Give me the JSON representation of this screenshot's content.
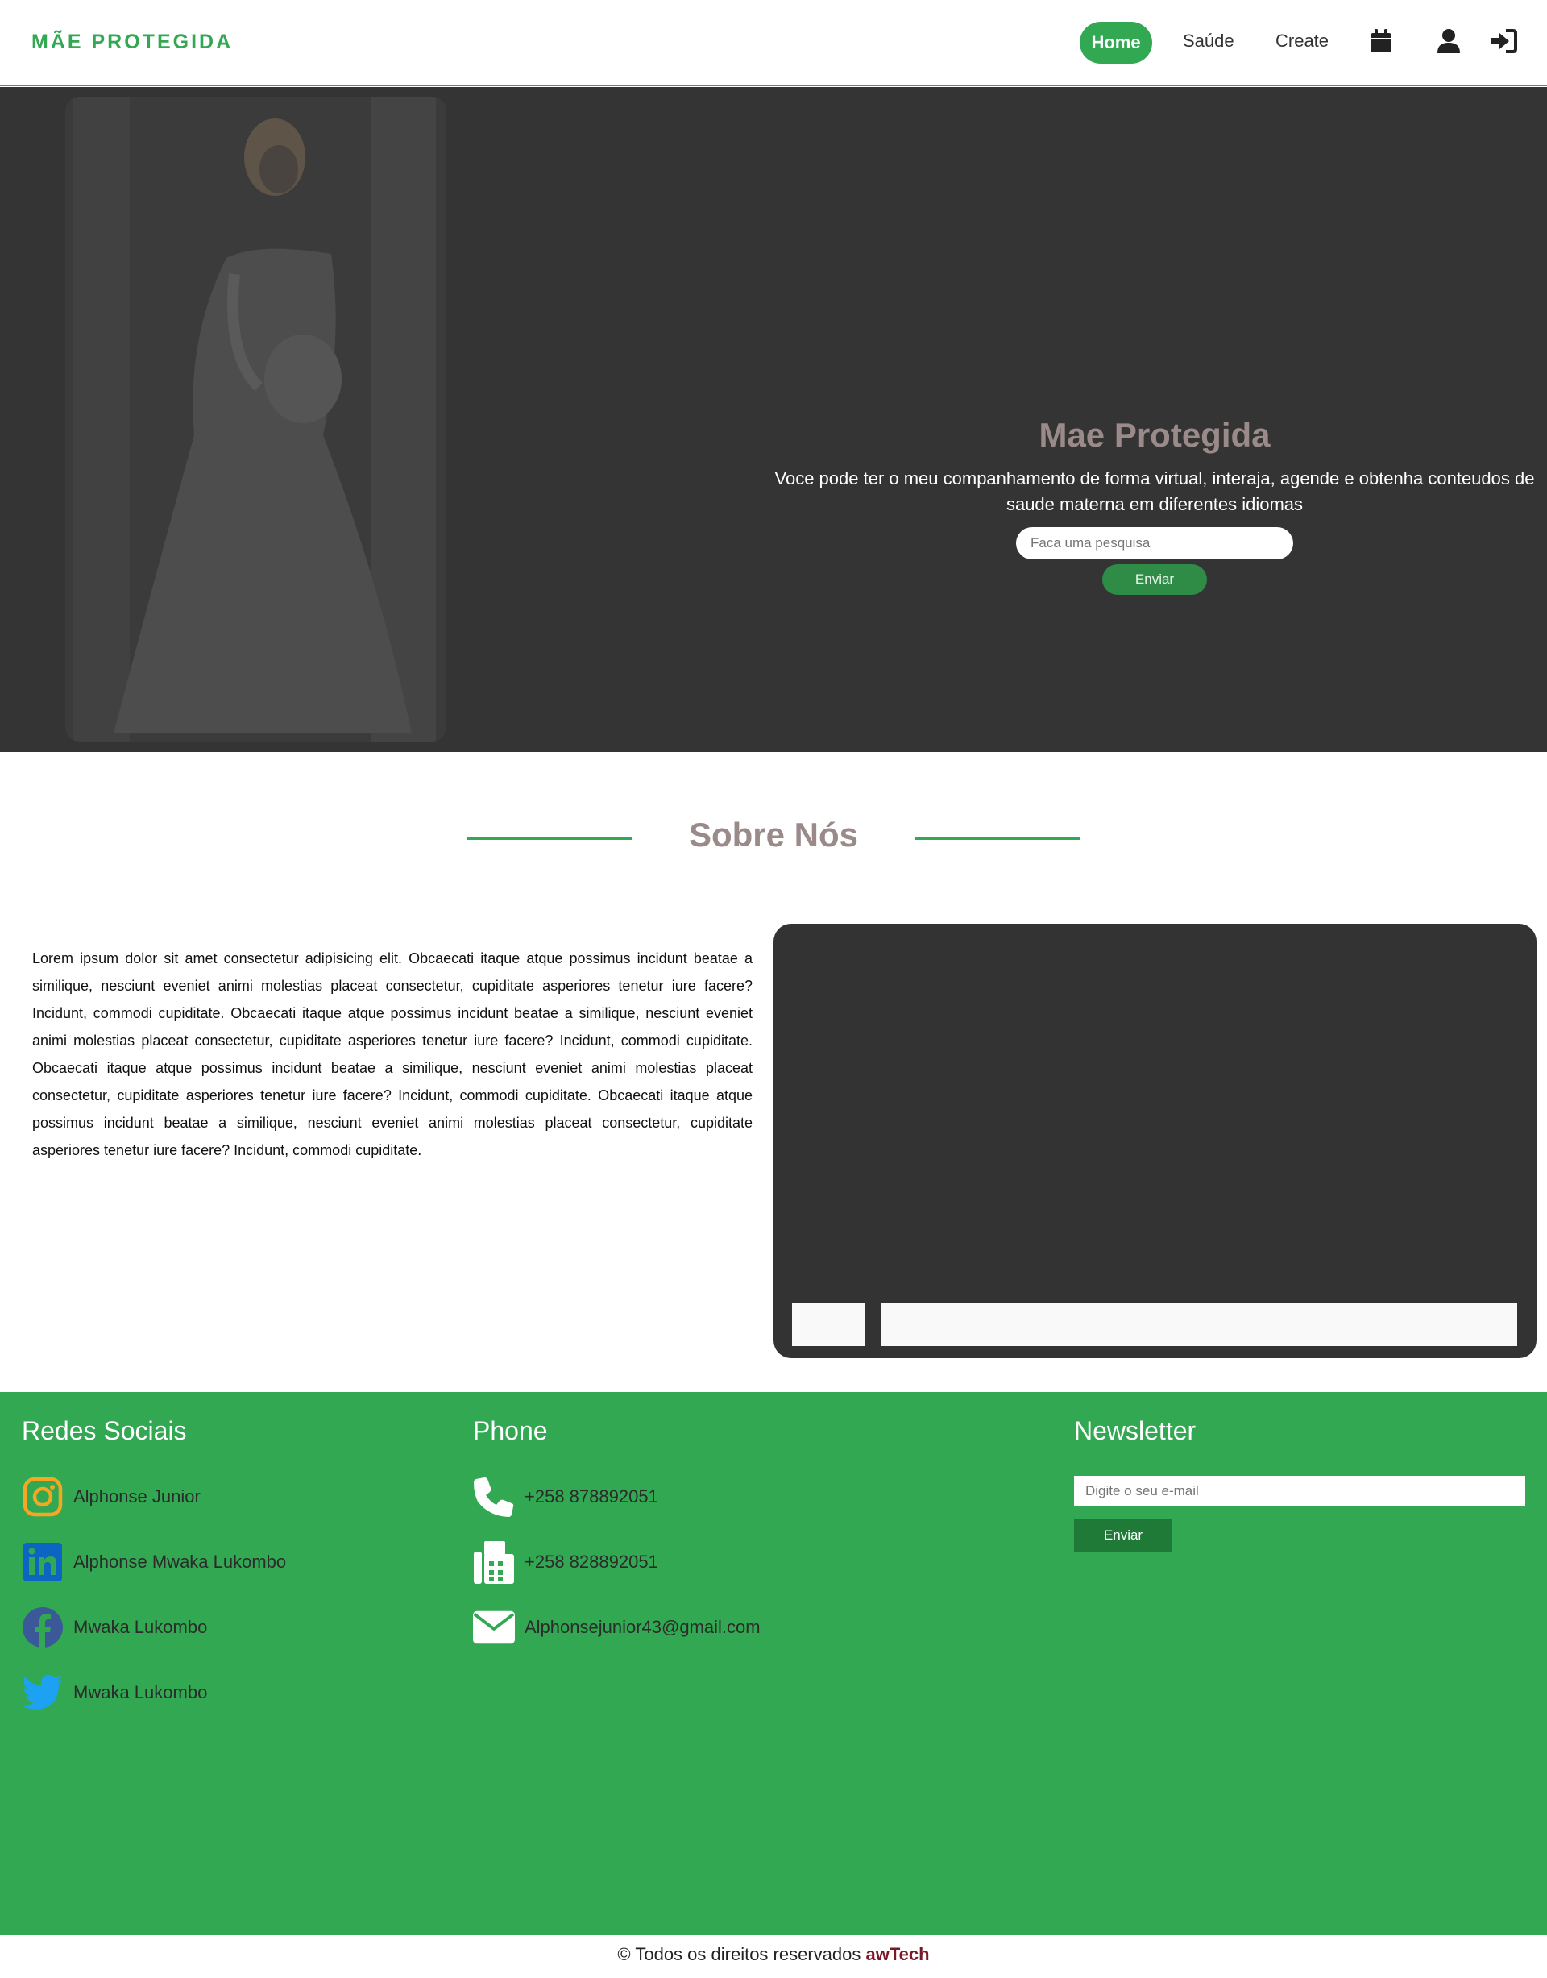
{
  "navbar": {
    "brand": "MÃE PROTEGIDA",
    "home": "Home",
    "saude": "Saúde",
    "create": "Create",
    "icons": [
      "calendar-icon",
      "user-icon",
      "login-icon"
    ]
  },
  "hero": {
    "title": "Mae Protegida",
    "text": "Voce pode ter o meu companhamento de forma virtual, interaja, agende e obtenha conteudos de saude materna em diferentes idiomas",
    "search_placeholder": "Faca uma pesquisa",
    "button": "Enviar"
  },
  "about": {
    "title": "Sobre Nós",
    "text": "Lorem ipsum dolor sit amet consectetur adipisicing elit. Obcaecati itaque atque possimus incidunt beatae a similique, nesciunt eveniet animi molestias placeat consectetur, cupiditate asperiores tenetur iure facere? Incidunt, commodi cupiditate. Obcaecati itaque atque possimus incidunt beatae a similique, nesciunt eveniet animi molestias placeat consectetur, cupiditate asperiores tenetur iure facere? Incidunt, commodi cupiditate. Obcaecati itaque atque possimus incidunt beatae a similique, nesciunt eveniet animi molestias placeat consectetur, cupiditate asperiores tenetur iure facere? Incidunt, commodi cupiditate. Obcaecati itaque atque possimus incidunt beatae a similique, nesciunt eveniet animi molestias placeat consectetur, cupiditate asperiores tenetur iure facere? Incidunt, commodi cupiditate."
  },
  "footer": {
    "social_title": "Redes Sociais",
    "social": [
      {
        "icon": "instagram-icon",
        "label": "Alphonse Junior"
      },
      {
        "icon": "linkedin-icon",
        "label": "Alphonse Mwaka Lukombo"
      },
      {
        "icon": "facebook-icon",
        "label": "Mwaka Lukombo"
      },
      {
        "icon": "twitter-icon",
        "label": "Mwaka Lukombo"
      }
    ],
    "phone_title": "Phone",
    "contacts": [
      {
        "icon": "phone-icon",
        "label": "+258 878892051"
      },
      {
        "icon": "fax-icon",
        "label": "+258 828892051"
      },
      {
        "icon": "envelope-icon",
        "label": "Alphonsejunior43@gmail.com"
      }
    ],
    "newsletter_title": "Newsletter",
    "newsletter_placeholder": "Digite o seu e-mail",
    "newsletter_button": "Enviar"
  },
  "copyright": {
    "text": "© Todos os direitos reservados ",
    "brand": "awTech"
  },
  "colors": {
    "accent": "#33a853",
    "hero_bg": "#343434",
    "title_gray": "#9a8a8a",
    "brand_red": "#7a1828"
  }
}
